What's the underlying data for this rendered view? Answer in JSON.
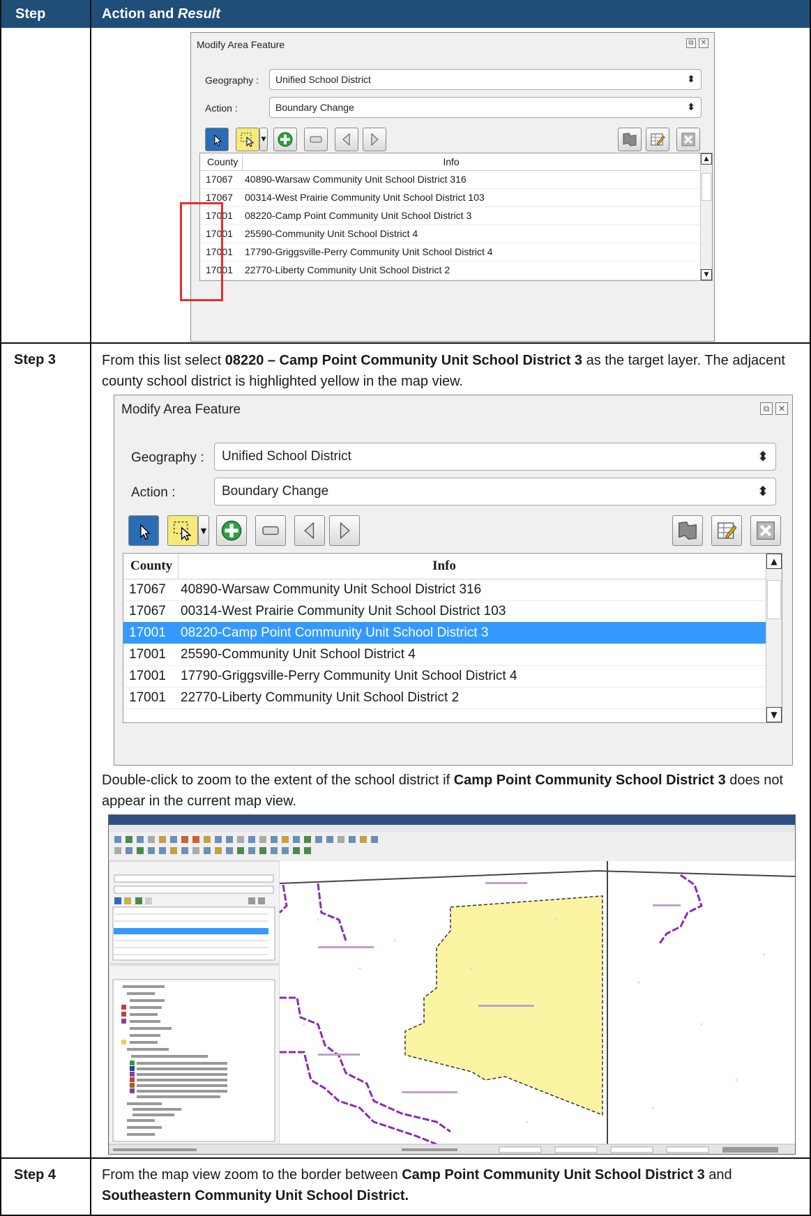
{
  "header": {
    "step": "Step",
    "action_prefix": "Action and ",
    "action_italic": "Result"
  },
  "dialog_title": "Modify Area Feature",
  "geography_label": "Geography :",
  "geography_value": "Unified School District",
  "action_label": "Action :",
  "action_value": "Boundary Change",
  "columns": {
    "county": "County",
    "info": "Info"
  },
  "rows": [
    {
      "county": "17067",
      "info": "40890-Warsaw Community Unit School District 316"
    },
    {
      "county": "17067",
      "info": "00314-West Prairie Community Unit School District 103"
    },
    {
      "county": "17001",
      "info": "08220-Camp Point Community Unit School District 3"
    },
    {
      "county": "17001",
      "info": "25590-Community Unit School District 4"
    },
    {
      "county": "17001",
      "info": "17790-Griggsville-Perry Community Unit School District 4"
    },
    {
      "county": "17001",
      "info": "22770-Liberty Community Unit School District 2"
    }
  ],
  "selected_row": 2,
  "step3": {
    "label": "Step 3",
    "t1": "From this list select ",
    "b1": "08220 – Camp Point Community Unit School District 3",
    "t2": " as the target layer. The adjacent county school district is highlighted yellow in the map view.",
    "t3": "Double-click to zoom to the extent of the school district if ",
    "b2": "Camp Point Community School District 3",
    "t4": " does not appear in the current map view."
  },
  "step4": {
    "label": "Step 4",
    "t1": "From the map view zoom to the border between ",
    "b1": "Camp Point Community Unit School District 3",
    "t2": " and ",
    "b2": "Southeastern Community Unit School District."
  },
  "colors": {
    "header_bg": "#1f4e79",
    "selection": "#3399ff",
    "highlight_fill": "#fbf5a3",
    "boundary_purple": "#8a2bb8",
    "red_box": "#e03030"
  }
}
